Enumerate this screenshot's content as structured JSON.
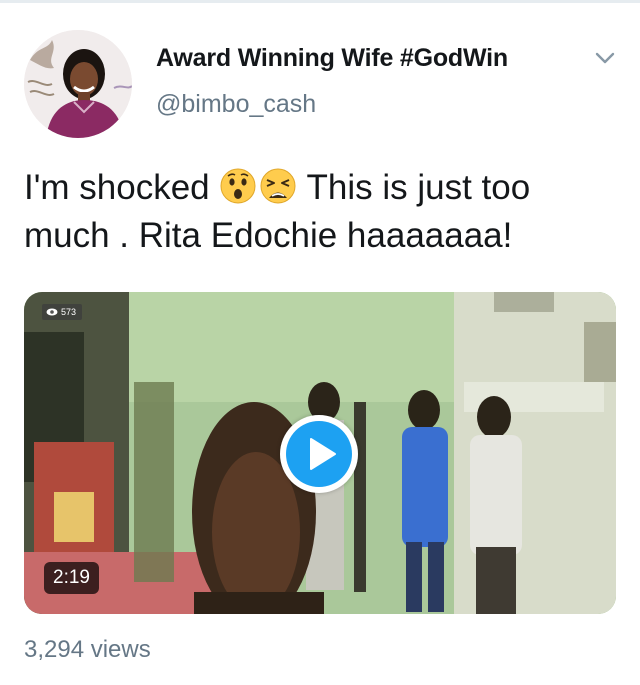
{
  "tweet": {
    "author": {
      "name": "Award Winning Wife #GodWin",
      "handle": "@bimbo_cash",
      "avatar_icon": "profile-photo-avatar"
    },
    "menu_icon": "chevron-down-icon",
    "text_part1": "I'm shocked",
    "emojis": [
      "hushed-face-emoji",
      "weary-face-emoji"
    ],
    "text_part2": "This is just too much . Rita Edochie haaaaaaa!",
    "video": {
      "overlay_views": "573",
      "duration": "2:19",
      "play_icon": "play-icon"
    },
    "view_count": "3,294 views"
  },
  "colors": {
    "text_primary": "#14171a",
    "text_secondary": "#657786",
    "accent_blue": "#1da1f2",
    "chevron": "#8899a6",
    "divider": "#e6ecf0"
  }
}
